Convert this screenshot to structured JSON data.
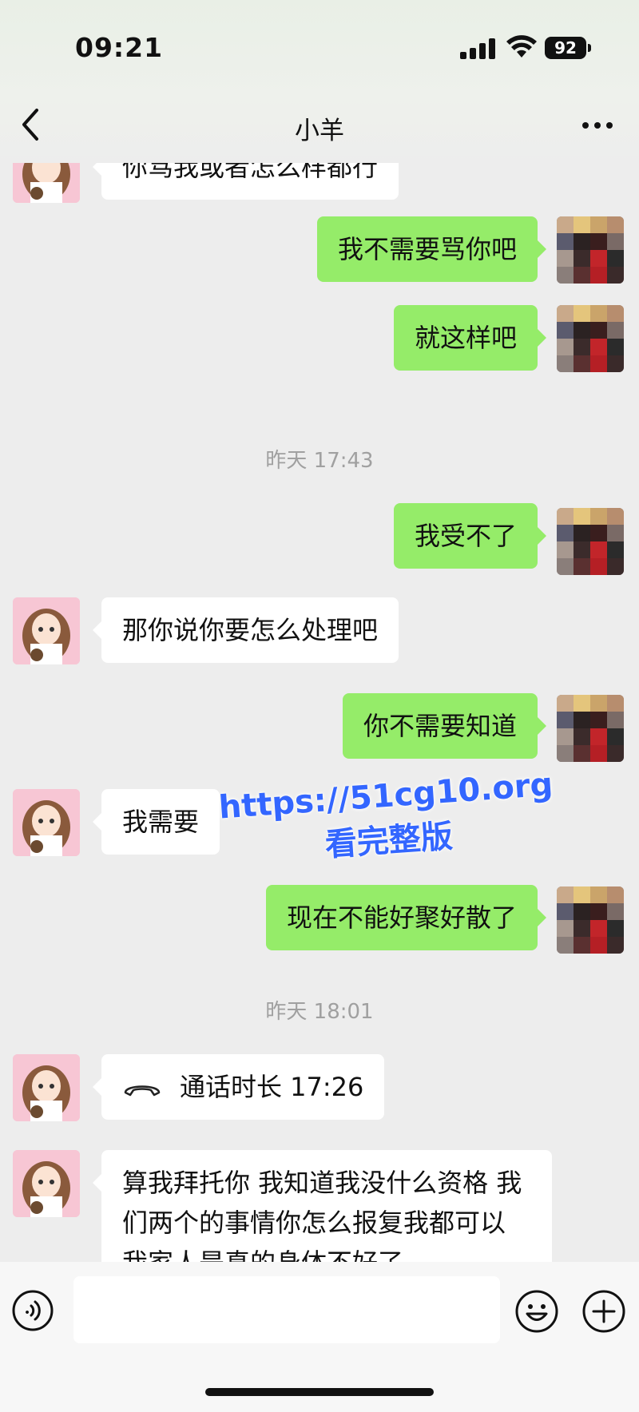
{
  "status_bar": {
    "time": "09:21",
    "battery": "92"
  },
  "header": {
    "title": "小羊"
  },
  "messages": {
    "m1": "你骂我或者怎么样都行",
    "m2": "我不需要骂你吧",
    "m3": "就这样吧",
    "ts1": "昨天 17:43",
    "m4": "我受不了",
    "m5": "那你说你要怎么处理吧",
    "m6": "你不需要知道",
    "m7": "我需要",
    "m8": "现在不能好聚好散了",
    "ts2": "昨天 18:01",
    "call": "通话时长 17:26",
    "m9": "算我拜托你 我知道我没什么资格 我们两个的事情你怎么报复我都可以 我家人是真的身体不好了"
  },
  "watermark": {
    "line1": "https://51cg10.org",
    "line2": "看完整版"
  },
  "colors": {
    "sent_bubble": "#95ec69",
    "received_bubble": "#ffffff",
    "background": "#ededed"
  },
  "icons": [
    "back-icon",
    "more-icon",
    "voice-icon",
    "emoji-icon",
    "plus-icon",
    "phone-icon"
  ]
}
